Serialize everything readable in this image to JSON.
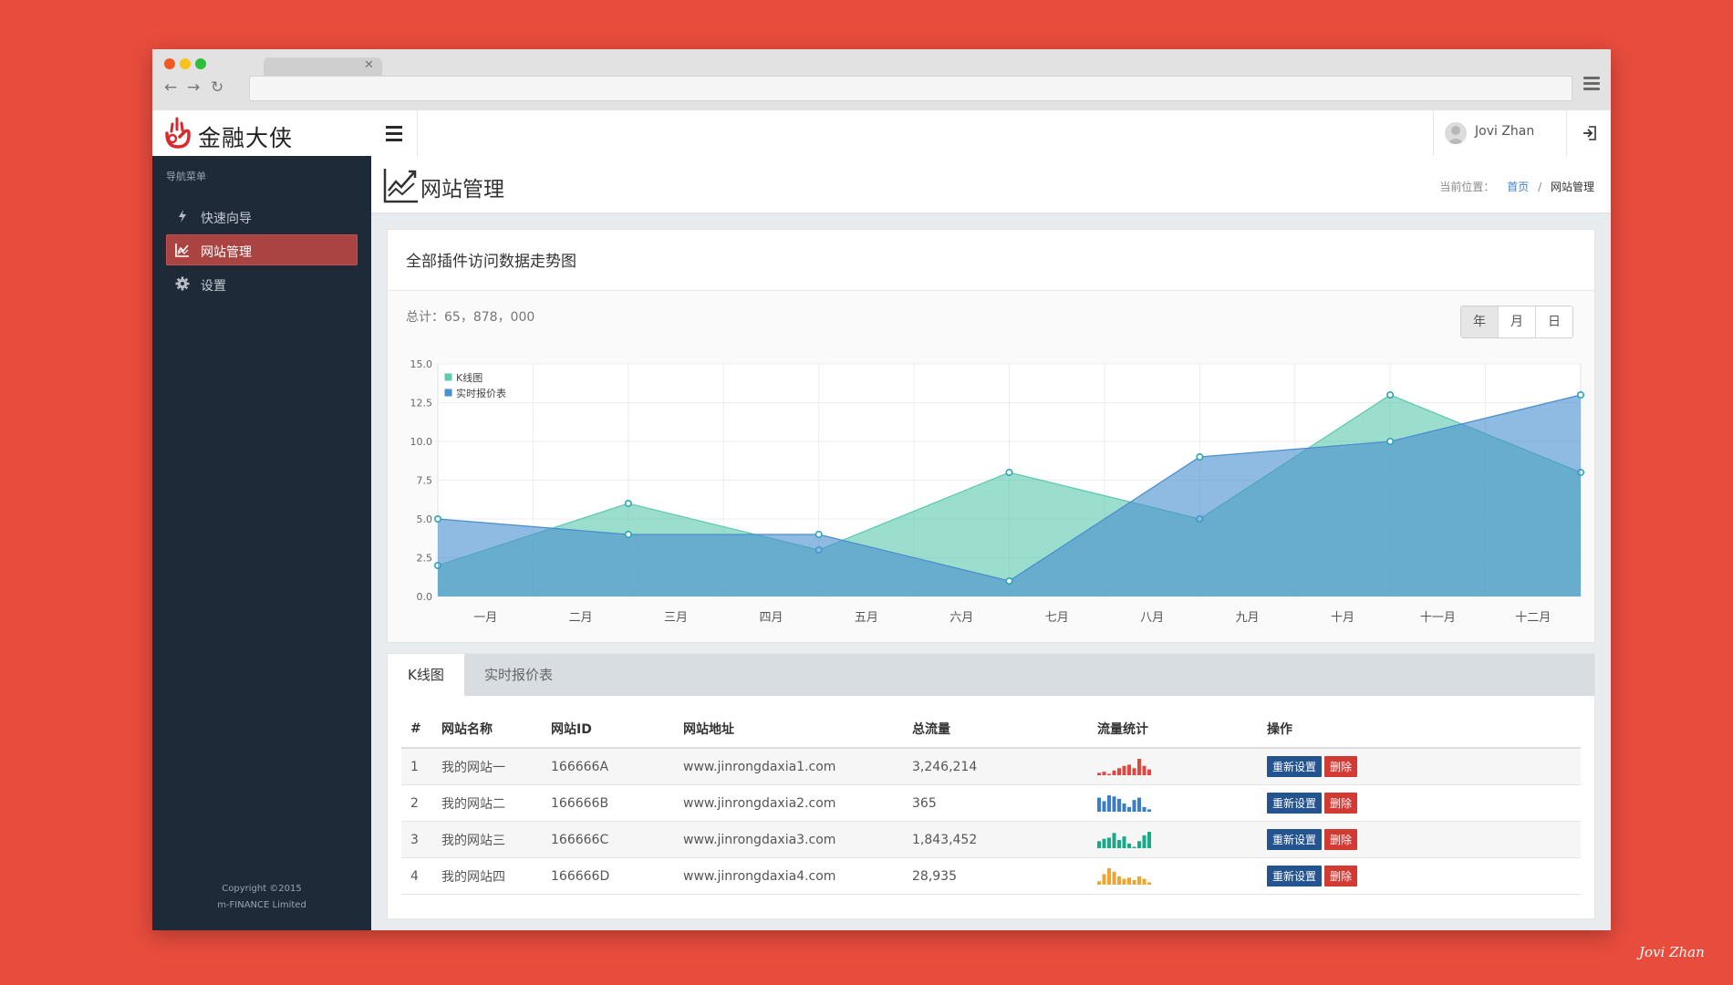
{
  "app": {
    "logo_text": "金融大侠",
    "user_name": "Jovi Zhan",
    "signature": "Jovi Zhan"
  },
  "sidebar": {
    "heading": "导航菜单",
    "items": [
      {
        "label": "快速向导",
        "icon": "bolt-icon"
      },
      {
        "label": "网站管理",
        "icon": "chart-line-icon",
        "active": true
      },
      {
        "label": "设置",
        "icon": "gear-icon"
      }
    ],
    "copyright": [
      "Copyright ©2015",
      "m-FINANCE Limited"
    ]
  },
  "page": {
    "title": "网站管理",
    "breadcrumb": {
      "label": "当前位置：",
      "home": "首页",
      "sep": "/",
      "current": "网站管理"
    }
  },
  "card": {
    "title": "全部插件访问数据走势图",
    "total": "总计：65，878，000",
    "periods": [
      "年",
      "月",
      "日"
    ]
  },
  "chart_data": {
    "type": "area",
    "x": [
      "一月",
      "二月",
      "三月",
      "四月",
      "五月",
      "六月",
      "七月",
      "八月",
      "九月",
      "十月",
      "十一月",
      "十二月"
    ],
    "series": [
      {
        "name": "K线图",
        "color": "#5fcab0",
        "values": [
          2.0,
          6.0,
          3.0,
          8.0,
          5.0,
          13.0,
          8.0
        ]
      },
      {
        "name": "实时报价表",
        "color": "#4a8fcf",
        "values": [
          5.0,
          4.0,
          4.0,
          1.0,
          9.0,
          10.0,
          13.0
        ]
      }
    ],
    "y_ticks": [
      "0.0",
      "2.5",
      "5.0",
      "7.5",
      "10.0",
      "12.5",
      "15.0"
    ],
    "ylim": [
      0,
      15
    ],
    "grid": true,
    "legend": "top-left"
  },
  "tabs": [
    "K线图",
    "实时报价表"
  ],
  "table": {
    "headers": [
      "#",
      "网站名称",
      "网站ID",
      "网站地址",
      "总流量",
      "流量统计",
      "操作"
    ],
    "rows": [
      {
        "num": "1",
        "name": "我的网站一",
        "id": "166666A",
        "url": "www.jinrongdaxia1.com",
        "traffic": "3,246,214",
        "spark_color": "#e1473e",
        "spark": [
          2,
          3,
          1,
          4,
          6,
          8,
          9,
          6,
          14,
          8,
          5
        ]
      },
      {
        "num": "2",
        "name": "我的网站二",
        "id": "166666B",
        "url": "www.jinrongdaxia2.com",
        "traffic": "365",
        "spark_color": "#3a7ec7",
        "spark": [
          12,
          9,
          14,
          13,
          11,
          7,
          4,
          10,
          12,
          4,
          2
        ]
      },
      {
        "num": "3",
        "name": "我的网站三",
        "id": "166666C",
        "url": "www.jinrongdaxia3.com",
        "traffic": "1,843,452",
        "spark_color": "#1aaa88",
        "spark": [
          6,
          8,
          9,
          13,
          7,
          10,
          4,
          1,
          6,
          11,
          14
        ]
      },
      {
        "num": "4",
        "name": "我的网站四",
        "id": "166666D",
        "url": "www.jinrongdaxia4.com",
        "traffic": "28,935",
        "spark_color": "#f0a531",
        "spark": [
          3,
          9,
          14,
          11,
          7,
          5,
          6,
          4,
          7,
          5,
          2
        ]
      }
    ],
    "btn_reset": "重新设置",
    "btn_delete": "删除"
  }
}
